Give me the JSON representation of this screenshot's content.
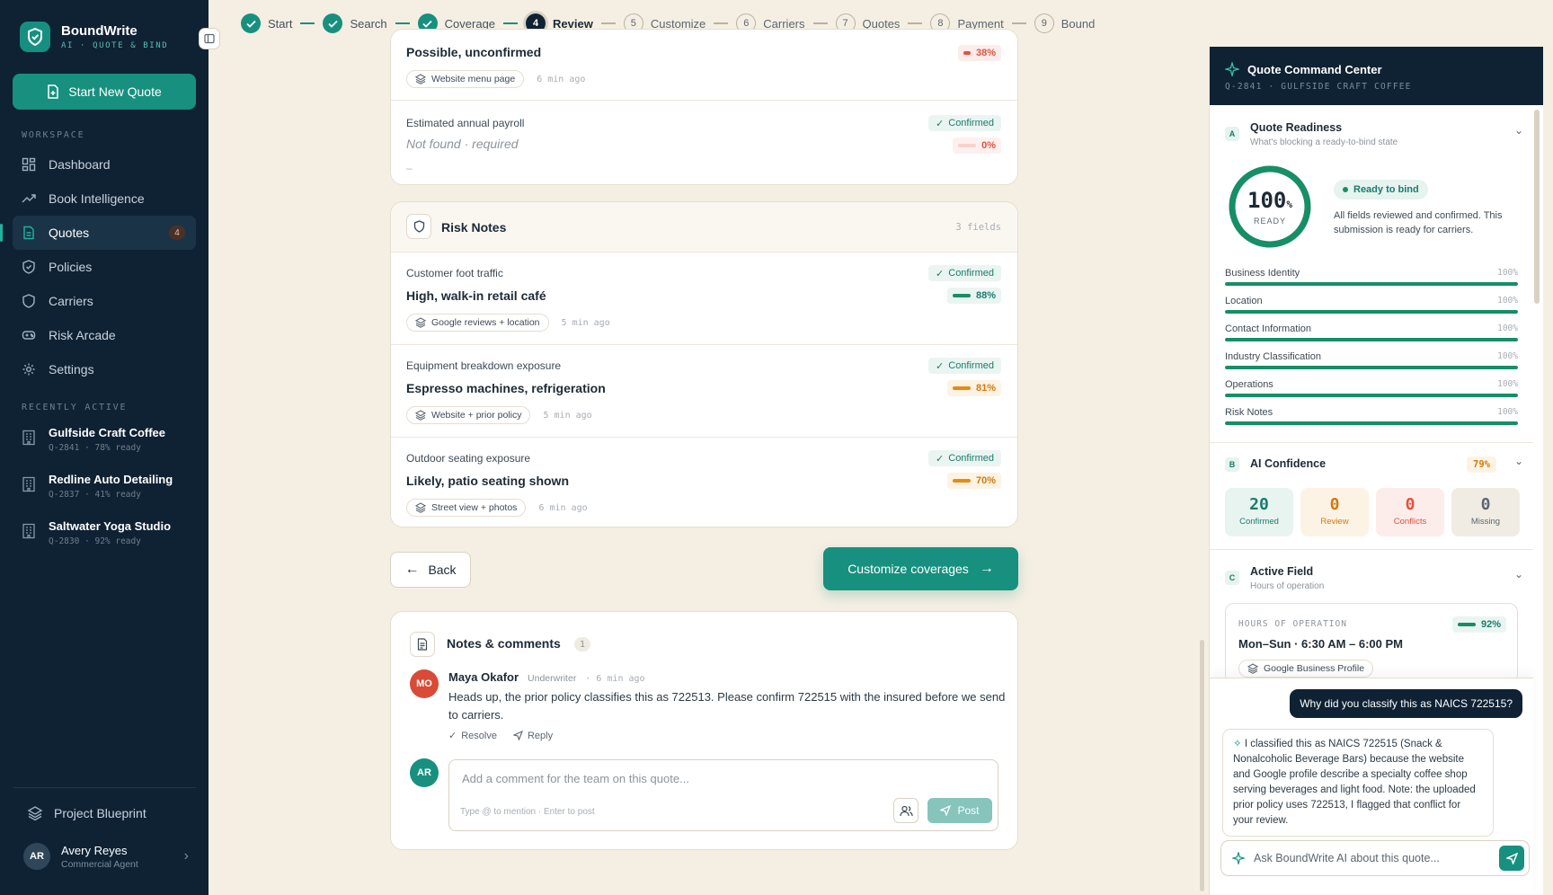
{
  "brand": {
    "name": "BoundWrite",
    "tagline": "AI · QUOTE & BIND"
  },
  "sidebar": {
    "new_quote_label": "Start New Quote",
    "workspace_label": "WORKSPACE",
    "nav": [
      {
        "label": "Dashboard",
        "icon": "dashboard-icon"
      },
      {
        "label": "Book Intelligence",
        "icon": "trend-icon"
      },
      {
        "label": "Quotes",
        "icon": "document-icon",
        "badge": "4",
        "active": true
      },
      {
        "label": "Policies",
        "icon": "shield-check-icon"
      },
      {
        "label": "Carriers",
        "icon": "shield-icon"
      },
      {
        "label": "Risk Arcade",
        "icon": "gamepad-icon"
      },
      {
        "label": "Settings",
        "icon": "gear-icon"
      }
    ],
    "recent_label": "RECENTLY ACTIVE",
    "recent": [
      {
        "name": "Gulfside Craft Coffee",
        "sub": "Q-2841 · 78% ready"
      },
      {
        "name": "Redline Auto Detailing",
        "sub": "Q-2837 · 41% ready"
      },
      {
        "name": "Saltwater Yoga Studio",
        "sub": "Q-2830 · 92% ready"
      }
    ],
    "blueprint_label": "Project Blueprint",
    "user": {
      "initials": "AR",
      "name": "Avery Reyes",
      "role": "Commercial Agent"
    }
  },
  "stepper": [
    {
      "num": "1",
      "label": "Start",
      "state": "done"
    },
    {
      "num": "2",
      "label": "Search",
      "state": "done"
    },
    {
      "num": "3",
      "label": "Coverage",
      "state": "done"
    },
    {
      "num": "4",
      "label": "Review",
      "state": "current"
    },
    {
      "num": "5",
      "label": "Customize",
      "state": "todo"
    },
    {
      "num": "6",
      "label": "Carriers",
      "state": "todo"
    },
    {
      "num": "7",
      "label": "Quotes",
      "state": "todo"
    },
    {
      "num": "8",
      "label": "Payment",
      "state": "todo"
    },
    {
      "num": "9",
      "label": "Bound",
      "state": "todo"
    }
  ],
  "operations_card": {
    "partial_value": "Possible, unconfirmed",
    "partial_conf": "38%",
    "partial_source": "Website menu page",
    "partial_time": "6 min ago",
    "payroll_label": "Estimated annual payroll",
    "payroll_status": "Confirmed",
    "payroll_value": "Not found · required",
    "payroll_conf": "0%",
    "payroll_dash": "–"
  },
  "risk_notes": {
    "title": "Risk Notes",
    "count": "3 fields",
    "fields": [
      {
        "label": "Customer foot traffic",
        "status": "Confirmed",
        "value": "High, walk-in retail café",
        "conf": "88%",
        "level": "green",
        "source": "Google reviews + location",
        "time": "5 min ago"
      },
      {
        "label": "Equipment breakdown exposure",
        "status": "Confirmed",
        "value": "Espresso machines, refrigeration",
        "conf": "81%",
        "level": "orange",
        "source": "Website + prior policy",
        "time": "5 min ago"
      },
      {
        "label": "Outdoor seating exposure",
        "status": "Confirmed",
        "value": "Likely, patio seating shown",
        "conf": "70%",
        "level": "orange",
        "source": "Street view + photos",
        "time": "6 min ago"
      }
    ]
  },
  "actions": {
    "back_label": "Back",
    "next_label": "Customize coverages"
  },
  "notes": {
    "title": "Notes & comments",
    "count": "1",
    "comment": {
      "initials": "MO",
      "author": "Maya Okafor",
      "role": "Underwriter",
      "time": "6 min ago",
      "text": "Heads up, the prior policy classifies this as 722513. Please confirm 722515 with the insured before we send to carriers.",
      "resolve_label": "Resolve",
      "reply_label": "Reply"
    },
    "me_initials": "AR",
    "input_placeholder": "Add a comment for the team on this quote...",
    "input_hint": "Type @ to mention · Enter to post",
    "post_label": "Post"
  },
  "panel": {
    "title": "Quote Command Center",
    "subtitle": "Q-2841 · GULFSIDE CRAFT COFFEE",
    "readiness": {
      "badge": "A",
      "title": "Quote Readiness",
      "subtitle": "What's blocking a ready-to-bind state",
      "value": "100",
      "unit": "%",
      "ready_word": "READY",
      "fraction": 1.0,
      "pill": "Ready to bind",
      "description": "All fields reviewed and confirmed. This submission is ready for carriers.",
      "items": [
        {
          "label": "Business Identity",
          "pct": "100%",
          "fraction": 1.0
        },
        {
          "label": "Location",
          "pct": "100%",
          "fraction": 1.0
        },
        {
          "label": "Contact Information",
          "pct": "100%",
          "fraction": 1.0
        },
        {
          "label": "Industry Classification",
          "pct": "100%",
          "fraction": 1.0
        },
        {
          "label": "Operations",
          "pct": "100%",
          "fraction": 1.0
        },
        {
          "label": "Risk Notes",
          "pct": "100%",
          "fraction": 1.0
        }
      ]
    },
    "confidence": {
      "badge": "B",
      "title": "AI Confidence",
      "pct": "79%",
      "stats": [
        {
          "n": "20",
          "label": "Confirmed",
          "bg": "#e8f4f0",
          "fg": "#1a7c6c"
        },
        {
          "n": "0",
          "label": "Review",
          "bg": "#fdf3e4",
          "fg": "#d3780d"
        },
        {
          "n": "0",
          "label": "Conflicts",
          "bg": "#fcecea",
          "fg": "#e2523c"
        },
        {
          "n": "0",
          "label": "Missing",
          "bg": "#f0ece4",
          "fg": "#5c6670"
        }
      ]
    },
    "active_field": {
      "badge": "C",
      "title": "Active Field",
      "subtitle": "Hours of operation",
      "field_label": "HOURS OF OPERATION",
      "conf": "92%",
      "value": "Mon–Sun · 6:30 AM – 6:00 PM",
      "source": "Google Business Profile"
    },
    "chat": {
      "user_msg": "Why did you classify this as NAICS 722515?",
      "ai_msg": "I classified this as NAICS 722515 (Snack & Nonalcoholic Beverage Bars) because the website and Google profile describe a specialty coffee shop serving beverages and light food. Note: the uploaded prior policy uses 722513, I flagged that conflict for your review.",
      "placeholder": "Ask BoundWrite AI about this quote..."
    }
  }
}
